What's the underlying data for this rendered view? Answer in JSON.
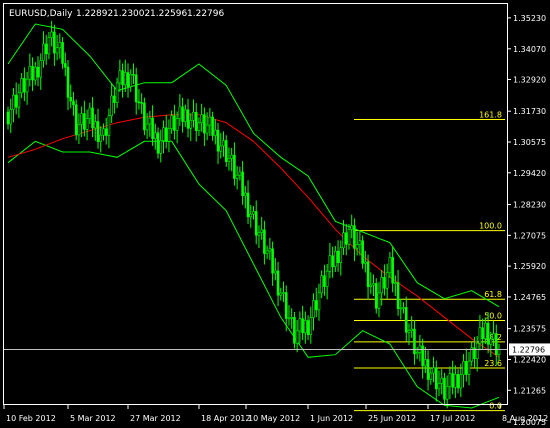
{
  "window": {
    "title": "EURUSD,Daily"
  },
  "header": {
    "symbol_period": "EURUSD,Daily",
    "ohlc": [
      "1.22892",
      "1.23002",
      "1.22596",
      "1.22796"
    ]
  },
  "colors": {
    "background": "#000000",
    "frame": "#ffffff",
    "candle": "#00ff00",
    "bollinger": "#00ff00",
    "moving_average": "#ff0000",
    "fibonacci": "#ffff00",
    "bid_line": "#c0c0c0",
    "current_price_label_bg": "#ffffff"
  },
  "chart_data": {
    "type": "candlestick",
    "symbol": "EURUSD",
    "timeframe": "Daily",
    "ylim": [
      1.2075,
      1.3575
    ],
    "y_ticks": [
      "1.35230",
      "1.34070",
      "1.32920",
      "1.31730",
      "1.30575",
      "1.29420",
      "1.28230",
      "1.27075",
      "1.25920",
      "1.24765",
      "1.23575",
      "1.22420",
      "1.21265",
      "1.20075"
    ],
    "x_ticks": [
      "10 Feb 2012",
      "5 Mar 2012",
      "27 Mar 2012",
      "18 Apr 2012",
      "10 May 2012",
      "1 Jun 2012",
      "25 Jun 2012",
      "17 Jul 2012",
      "8 Aug 2012"
    ],
    "current_price": "1.22796",
    "fibonacci": {
      "levels": [
        {
          "label": "161.8",
          "price": 1.3142
        },
        {
          "label": "100.0",
          "price": 1.2725
        },
        {
          "label": "61.8",
          "price": 1.2468
        },
        {
          "label": "50.0",
          "price": 1.2388
        },
        {
          "label": "38.2",
          "price": 1.2308
        },
        {
          "label": "23.6",
          "price": 1.221
        },
        {
          "label": "0.0",
          "price": 1.205
        }
      ]
    },
    "series": [
      {
        "kind": "moving_average",
        "x": [
          0,
          10,
          20,
          30,
          40,
          50,
          60,
          70,
          80,
          90,
          100,
          110,
          120,
          130,
          140,
          150,
          160,
          170,
          180
        ],
        "values": [
          1.3,
          1.303,
          1.307,
          1.31,
          1.313,
          1.315,
          1.316,
          1.316,
          1.313,
          1.306,
          1.296,
          1.285,
          1.273,
          1.263,
          1.255,
          1.248,
          1.24,
          1.232,
          1.225
        ]
      },
      {
        "kind": "bollinger_upper",
        "x": [
          0,
          10,
          20,
          30,
          40,
          50,
          60,
          70,
          80,
          90,
          100,
          110,
          120,
          130,
          140,
          150,
          160,
          170,
          180
        ],
        "values": [
          1.335,
          1.35,
          1.348,
          1.338,
          1.325,
          1.328,
          1.328,
          1.335,
          1.327,
          1.309,
          1.3,
          1.293,
          1.276,
          1.272,
          1.268,
          1.253,
          1.247,
          1.25,
          1.244
        ]
      },
      {
        "kind": "bollinger_lower",
        "x": [
          0,
          10,
          20,
          30,
          40,
          50,
          60,
          70,
          80,
          90,
          100,
          110,
          120,
          130,
          140,
          150,
          160,
          170,
          180
        ],
        "values": [
          1.298,
          1.306,
          1.302,
          1.302,
          1.3,
          1.306,
          1.306,
          1.29,
          1.28,
          1.26,
          1.24,
          1.225,
          1.226,
          1.235,
          1.23,
          1.214,
          1.207,
          1.206,
          1.21
        ]
      },
      {
        "kind": "close",
        "x": [
          0,
          5,
          10,
          15,
          20,
          25,
          30,
          35,
          40,
          45,
          50,
          55,
          60,
          65,
          70,
          75,
          80,
          85,
          90,
          95,
          100,
          105,
          110,
          115,
          120,
          125,
          130,
          135,
          140,
          145,
          150,
          155,
          160,
          165,
          170,
          175,
          180
        ],
        "values": [
          1.317,
          1.326,
          1.332,
          1.345,
          1.337,
          1.312,
          1.314,
          1.308,
          1.327,
          1.332,
          1.313,
          1.306,
          1.312,
          1.316,
          1.313,
          1.31,
          1.302,
          1.29,
          1.277,
          1.264,
          1.25,
          1.233,
          1.238,
          1.252,
          1.263,
          1.273,
          1.262,
          1.247,
          1.258,
          1.241,
          1.226,
          1.22,
          1.212,
          1.218,
          1.225,
          1.236,
          1.228
        ]
      }
    ]
  }
}
